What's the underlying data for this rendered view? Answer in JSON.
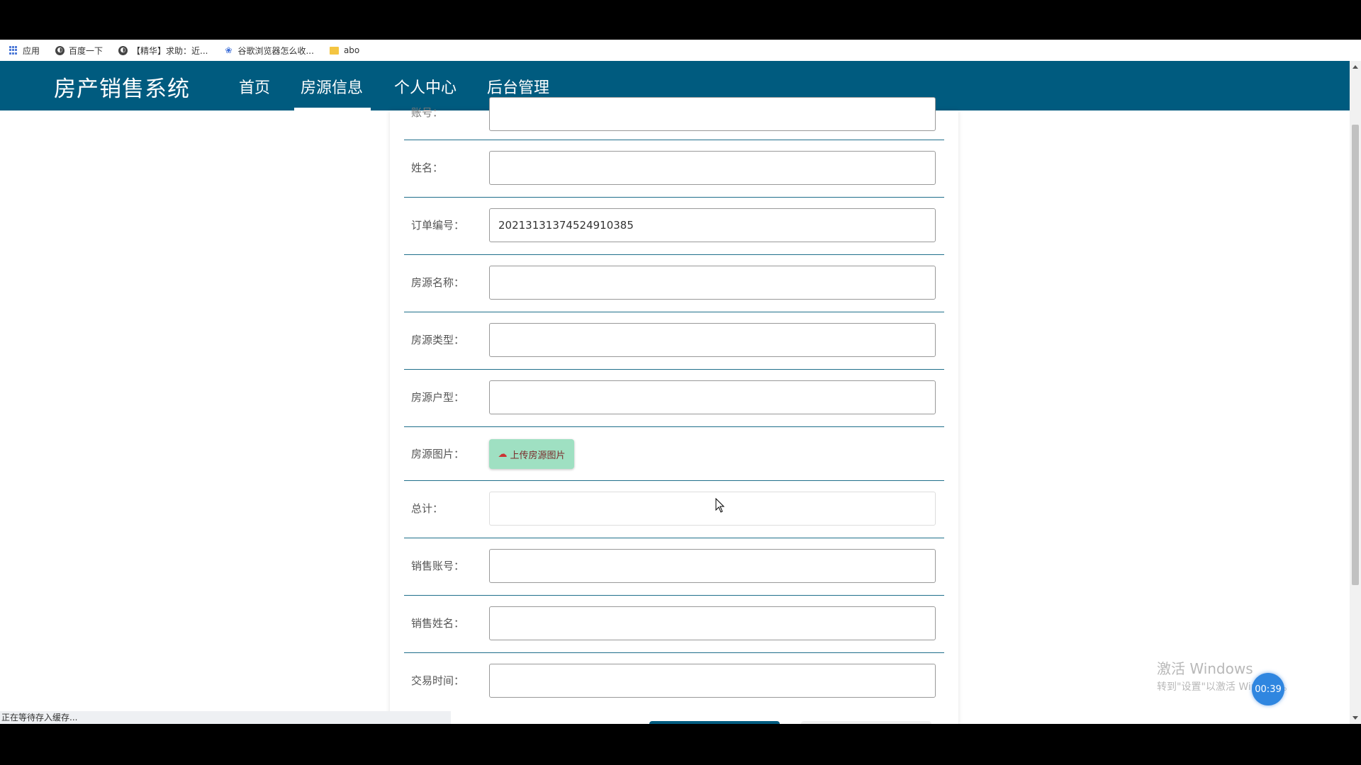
{
  "bookmarks": [
    {
      "label": "应用",
      "icon": "apps-icon"
    },
    {
      "label": "百度一下",
      "icon": "globe-icon"
    },
    {
      "label": "【精华】求助：近...",
      "icon": "globe-icon"
    },
    {
      "label": "谷歌浏览器怎么收...",
      "icon": "paw-icon"
    },
    {
      "label": "abo",
      "icon": "folder-icon"
    }
  ],
  "navbar": {
    "brand": "房产销售系统",
    "items": [
      "首页",
      "房源信息",
      "个人中心",
      "后台管理"
    ],
    "active_item": "房源信息"
  },
  "form": {
    "partial_label": "账号：",
    "fields": [
      {
        "label": "姓名：",
        "value": ""
      },
      {
        "label": "订单编号：",
        "value": "20213131374524910385"
      },
      {
        "label": "房源名称：",
        "value": ""
      },
      {
        "label": "房源类型：",
        "value": ""
      },
      {
        "label": "房源户型：",
        "value": ""
      },
      {
        "label": "房源图片：",
        "button": "上传房源图片"
      },
      {
        "label": "总计：",
        "value": ""
      },
      {
        "label": "销售账号：",
        "value": ""
      },
      {
        "label": "销售姓名：",
        "value": ""
      },
      {
        "label": "交易时间：",
        "value": ""
      }
    ]
  },
  "status_bar": "正在等待存入缓存...",
  "watermark": {
    "line1": "激活 Windows",
    "line2": "转到\"设置\"以激活 Windows。"
  },
  "timer": "00:39",
  "colors": {
    "navbar": "#005b7f",
    "upload_button": "#9fe0c2",
    "row_divider": "#1f6f8b"
  }
}
